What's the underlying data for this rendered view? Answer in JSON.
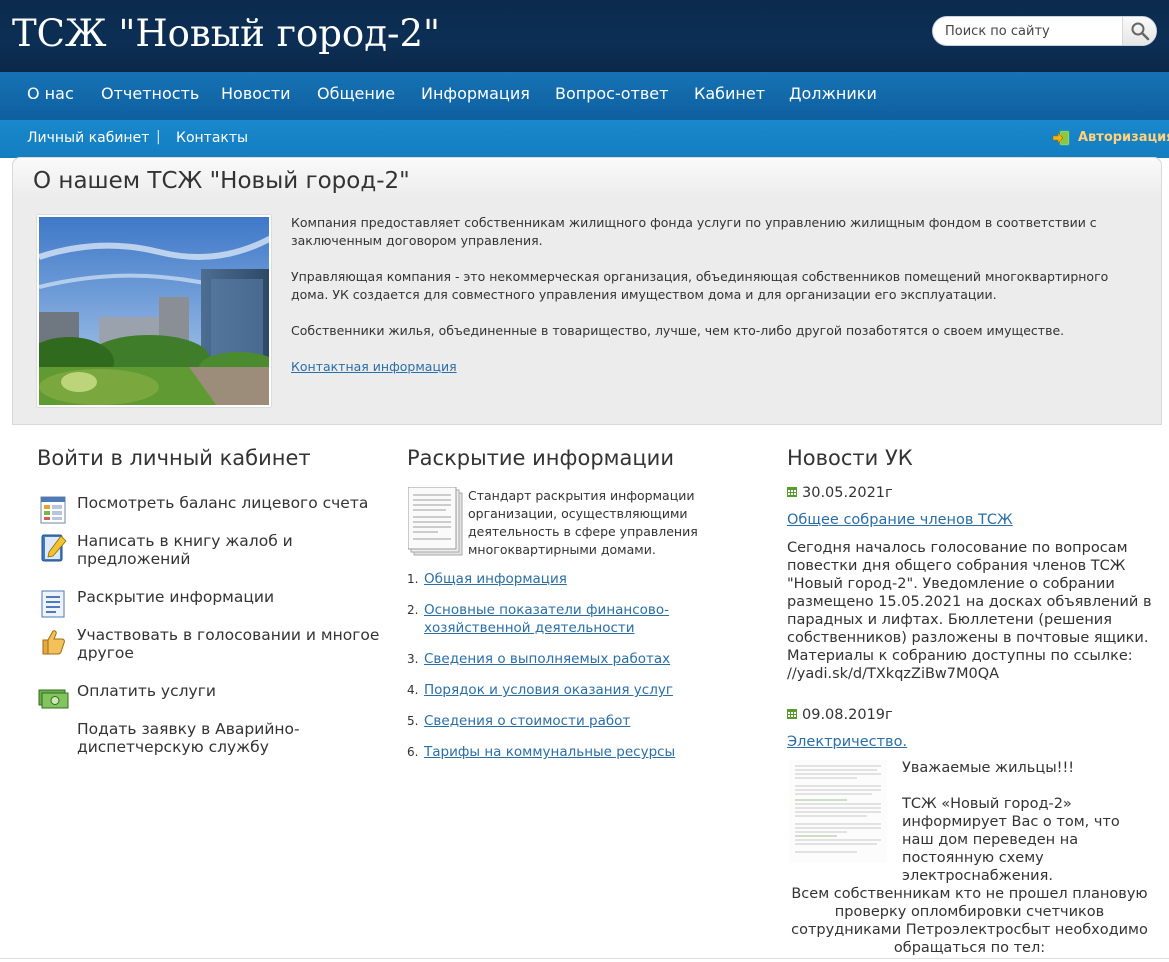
{
  "header": {
    "site_title": "ТСЖ \"Новый город-2\"",
    "search_placeholder": "Поиск по сайту"
  },
  "main_nav": [
    {
      "label": "О нас"
    },
    {
      "label": "Отчетность"
    },
    {
      "label": "Новости"
    },
    {
      "label": "Общение"
    },
    {
      "label": "Информация"
    },
    {
      "label": "Вопрос-ответ"
    },
    {
      "label": "Кабинет"
    },
    {
      "label": "Должники"
    }
  ],
  "sub_nav": {
    "items": [
      {
        "label": "Личный кабинет"
      },
      {
        "label": "Контакты"
      }
    ],
    "separator": "|",
    "auth_label": "Авторизация"
  },
  "about": {
    "title": "О нашем ТСЖ \"Новый город-2\"",
    "paragraphs": [
      "Компания предоставляет собственникам жилищного фонда услуги по управлению жилищным фондом в соответствии с заключенным договором управления.",
      "Управляющая компания - это некоммерческая организация, объединяющая собственников помещений многоквартирного дома. УК создается для совместного управления имуществом дома и для организации его эксплуатации.",
      "Собственники жилья, объединенные в товарищество, лучше, чем кто-либо другой позаботятся о своем имуществе."
    ],
    "contact_link": "Контактная информация"
  },
  "cabinet": {
    "title": "Войти в личный кабинет",
    "items": [
      {
        "label": "Посмотреть баланс лицевого счета",
        "icon": "balance-sheet-icon"
      },
      {
        "label": "Написать в книгу жалоб и предложений",
        "icon": "notebook-pen-icon"
      },
      {
        "label": "Раскрытие информации",
        "icon": "document-list-icon"
      },
      {
        "label": "Участвовать в голосовании и многое другое",
        "icon": "thumbs-up-icon"
      },
      {
        "label": "Оплатить услуги",
        "icon": "money-icon"
      },
      {
        "label": "Подать заявку в Аварийно-диспетчерскую службу",
        "icon": ""
      }
    ]
  },
  "disclosure": {
    "title": "Раскрытие информации",
    "intro": "Стандарт раскрытия информации организации, осуществляющими деятельность в сфере управления многоквартирными домами.",
    "items": [
      {
        "num": "1.",
        "label": "Общая информация"
      },
      {
        "num": "2.",
        "label": "Основные показатели финансово-хозяйственной деятельности"
      },
      {
        "num": "3.",
        "label": "Сведения о выполняемых работах"
      },
      {
        "num": "4.",
        "label": "Порядок и условия оказания услуг"
      },
      {
        "num": "5.",
        "label": "Сведения о стоимости работ"
      },
      {
        "num": "6.",
        "label": "Тарифы на коммунальные ресурсы"
      }
    ]
  },
  "news": {
    "title": "Новости УК",
    "items": [
      {
        "date": "30.05.2021г",
        "title": "Общее собрание членов ТСЖ",
        "body": "Сегодня началось голосование по вопросам повестки дня общего собрания членов ТСЖ \"Новый город-2\". Уведомление о собрании размещено 15.05.2021 на досках объявлений в парадных и лифтах. Бюллетени (решения собственников) разложены в почтовые ящики. Материалы к собранию доступны по ссылке: //yadi.sk/d/TXkqzZiBw7M0QA"
      },
      {
        "date": "09.08.2019г",
        "title": "Электричество.",
        "greeting": "Уважаемые жильцы!!!",
        "body": "ТСЖ «Новый город-2» информирует Вас о том, что наш дом переведен на постоянную схему электроснабжения.",
        "tail": "Всем собственникам кто не прошел плановую проверку опломбировки счетчиков сотрудниками Петроэлектросбыт необходимо обращаться по тел:"
      }
    ]
  },
  "colors": {
    "header_bg": "#0d2f55",
    "nav_bg": "#1673b4",
    "subnav_bg": "#1a88cc",
    "link": "#2a6ea8",
    "auth": "#ffd37a"
  }
}
